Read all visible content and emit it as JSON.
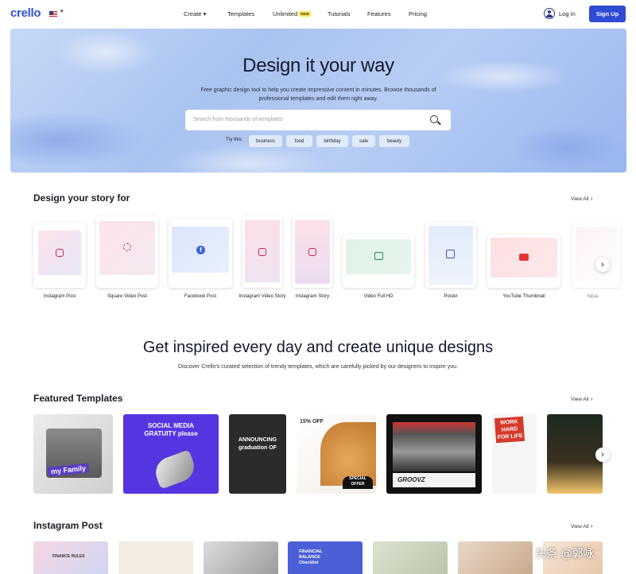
{
  "header": {
    "logo": "crello",
    "menu": {
      "create": "Create ▾",
      "templates": "Templates",
      "unlimited": "Unlimited",
      "unlimited_badge": "NEW",
      "tutorials": "Tutorials",
      "features": "Features",
      "pricing": "Pricing"
    },
    "login": "Log In",
    "signup": "Sign Up"
  },
  "hero": {
    "title": "Design it your way",
    "subtitle": "Free graphic design tool to help you create impressive content in minutes. Browse thousands of professional templates and edit them right away.",
    "search_placeholder": "Search from thousands of templates",
    "try_label": "Try this:",
    "chips": [
      "business",
      "food",
      "birthday",
      "sale",
      "beauty"
    ]
  },
  "story": {
    "title": "Design your story for",
    "view_all": "View All",
    "items": [
      {
        "label": "Instagram Post",
        "icon": "instagram-icon"
      },
      {
        "label": "Square Video Post",
        "icon": "loader-icon"
      },
      {
        "label": "Facebook Post",
        "icon": "facebook-icon"
      },
      {
        "label": "Instagram Video Story",
        "icon": "instagram-icon"
      },
      {
        "label": "Instagram Story",
        "icon": "instagram-icon"
      },
      {
        "label": "Video Full HD",
        "icon": "play-icon"
      },
      {
        "label": "Poster",
        "icon": "poster-icon"
      },
      {
        "label": "YouTube Thumbnail",
        "icon": "youtube-icon"
      },
      {
        "label": "Squa",
        "icon": "none"
      }
    ]
  },
  "inspire": {
    "title": "Get inspired every day and create unique designs",
    "subtitle": "Discover Crello's curated selection of trendy templates, which are carefully picked by our designers to inspire you."
  },
  "featured": {
    "title": "Featured Templates",
    "view_all": "View All",
    "cards": [
      {
        "text": "my Family"
      },
      {
        "text": "SOCIAL MEDIA GRATUITY please"
      },
      {
        "text": "ANNOUNCING graduation OF"
      },
      {
        "text": "15% OFF",
        "text2": "SPECIAL OFFER"
      },
      {
        "text": "GROOVZ"
      },
      {
        "text": "WORK HARD FOR LIFE"
      },
      {
        "text": ""
      }
    ]
  },
  "instagram": {
    "title": "Instagram Post",
    "view_all": "View All",
    "cards": [
      {
        "text": "FINANCE RULES"
      },
      {
        "text": ""
      },
      {
        "text": ""
      },
      {
        "text": "FINANCIAL BALANCE Checklist"
      },
      {
        "text": ""
      },
      {
        "text": ""
      },
      {
        "text": ""
      }
    ]
  },
  "watermark": "头条 @郭咏"
}
